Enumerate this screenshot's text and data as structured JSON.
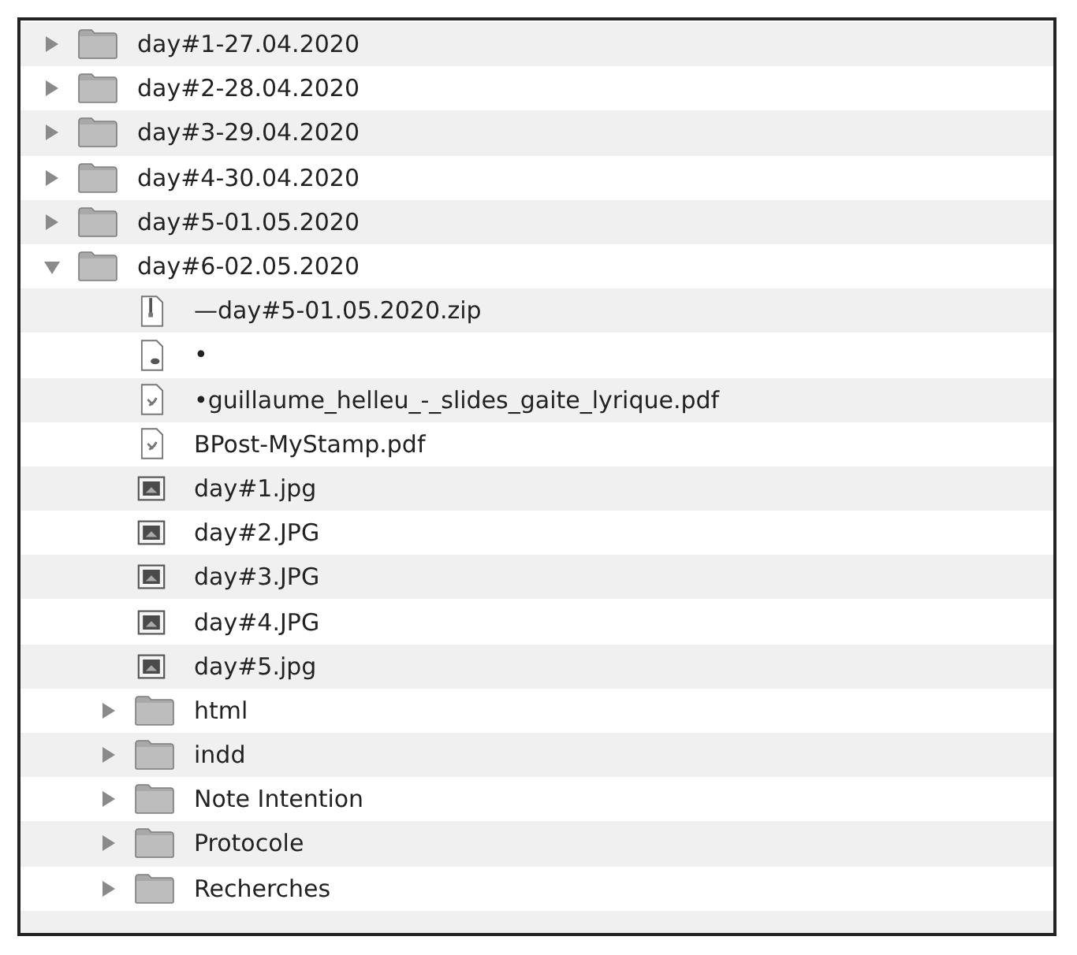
{
  "items": [
    {
      "name": "day#1-27.04.2020",
      "kind": "folder",
      "expanded": false
    },
    {
      "name": "day#2-28.04.2020",
      "kind": "folder",
      "expanded": false
    },
    {
      "name": "day#3-29.04.2020",
      "kind": "folder",
      "expanded": false
    },
    {
      "name": "day#4-30.04.2020",
      "kind": "folder",
      "expanded": false
    },
    {
      "name": "day#5-01.05.2020",
      "kind": "folder",
      "expanded": false
    },
    {
      "name": "day#6-02.05.2020",
      "kind": "folder",
      "expanded": true,
      "children": [
        {
          "name": "—day#5-01.05.2020.zip",
          "kind": "zip"
        },
        {
          "name": "•",
          "kind": "document"
        },
        {
          "name": "•guillaume_helleu_-_slides_gaite_lyrique.pdf",
          "kind": "pdf"
        },
        {
          "name": "BPost-MyStamp.pdf",
          "kind": "pdf"
        },
        {
          "name": "day#1.jpg",
          "kind": "image"
        },
        {
          "name": "day#2.JPG",
          "kind": "image"
        },
        {
          "name": "day#3.JPG",
          "kind": "image"
        },
        {
          "name": "day#4.JPG",
          "kind": "image"
        },
        {
          "name": "day#5.jpg",
          "kind": "image"
        },
        {
          "name": "html",
          "kind": "folder",
          "expanded": false
        },
        {
          "name": "indd",
          "kind": "folder",
          "expanded": false
        },
        {
          "name": "Note Intention",
          "kind": "folder",
          "expanded": false
        },
        {
          "name": "Protocole",
          "kind": "folder",
          "expanded": false
        },
        {
          "name": "Recherches",
          "kind": "folder",
          "expanded": false
        }
      ]
    }
  ]
}
